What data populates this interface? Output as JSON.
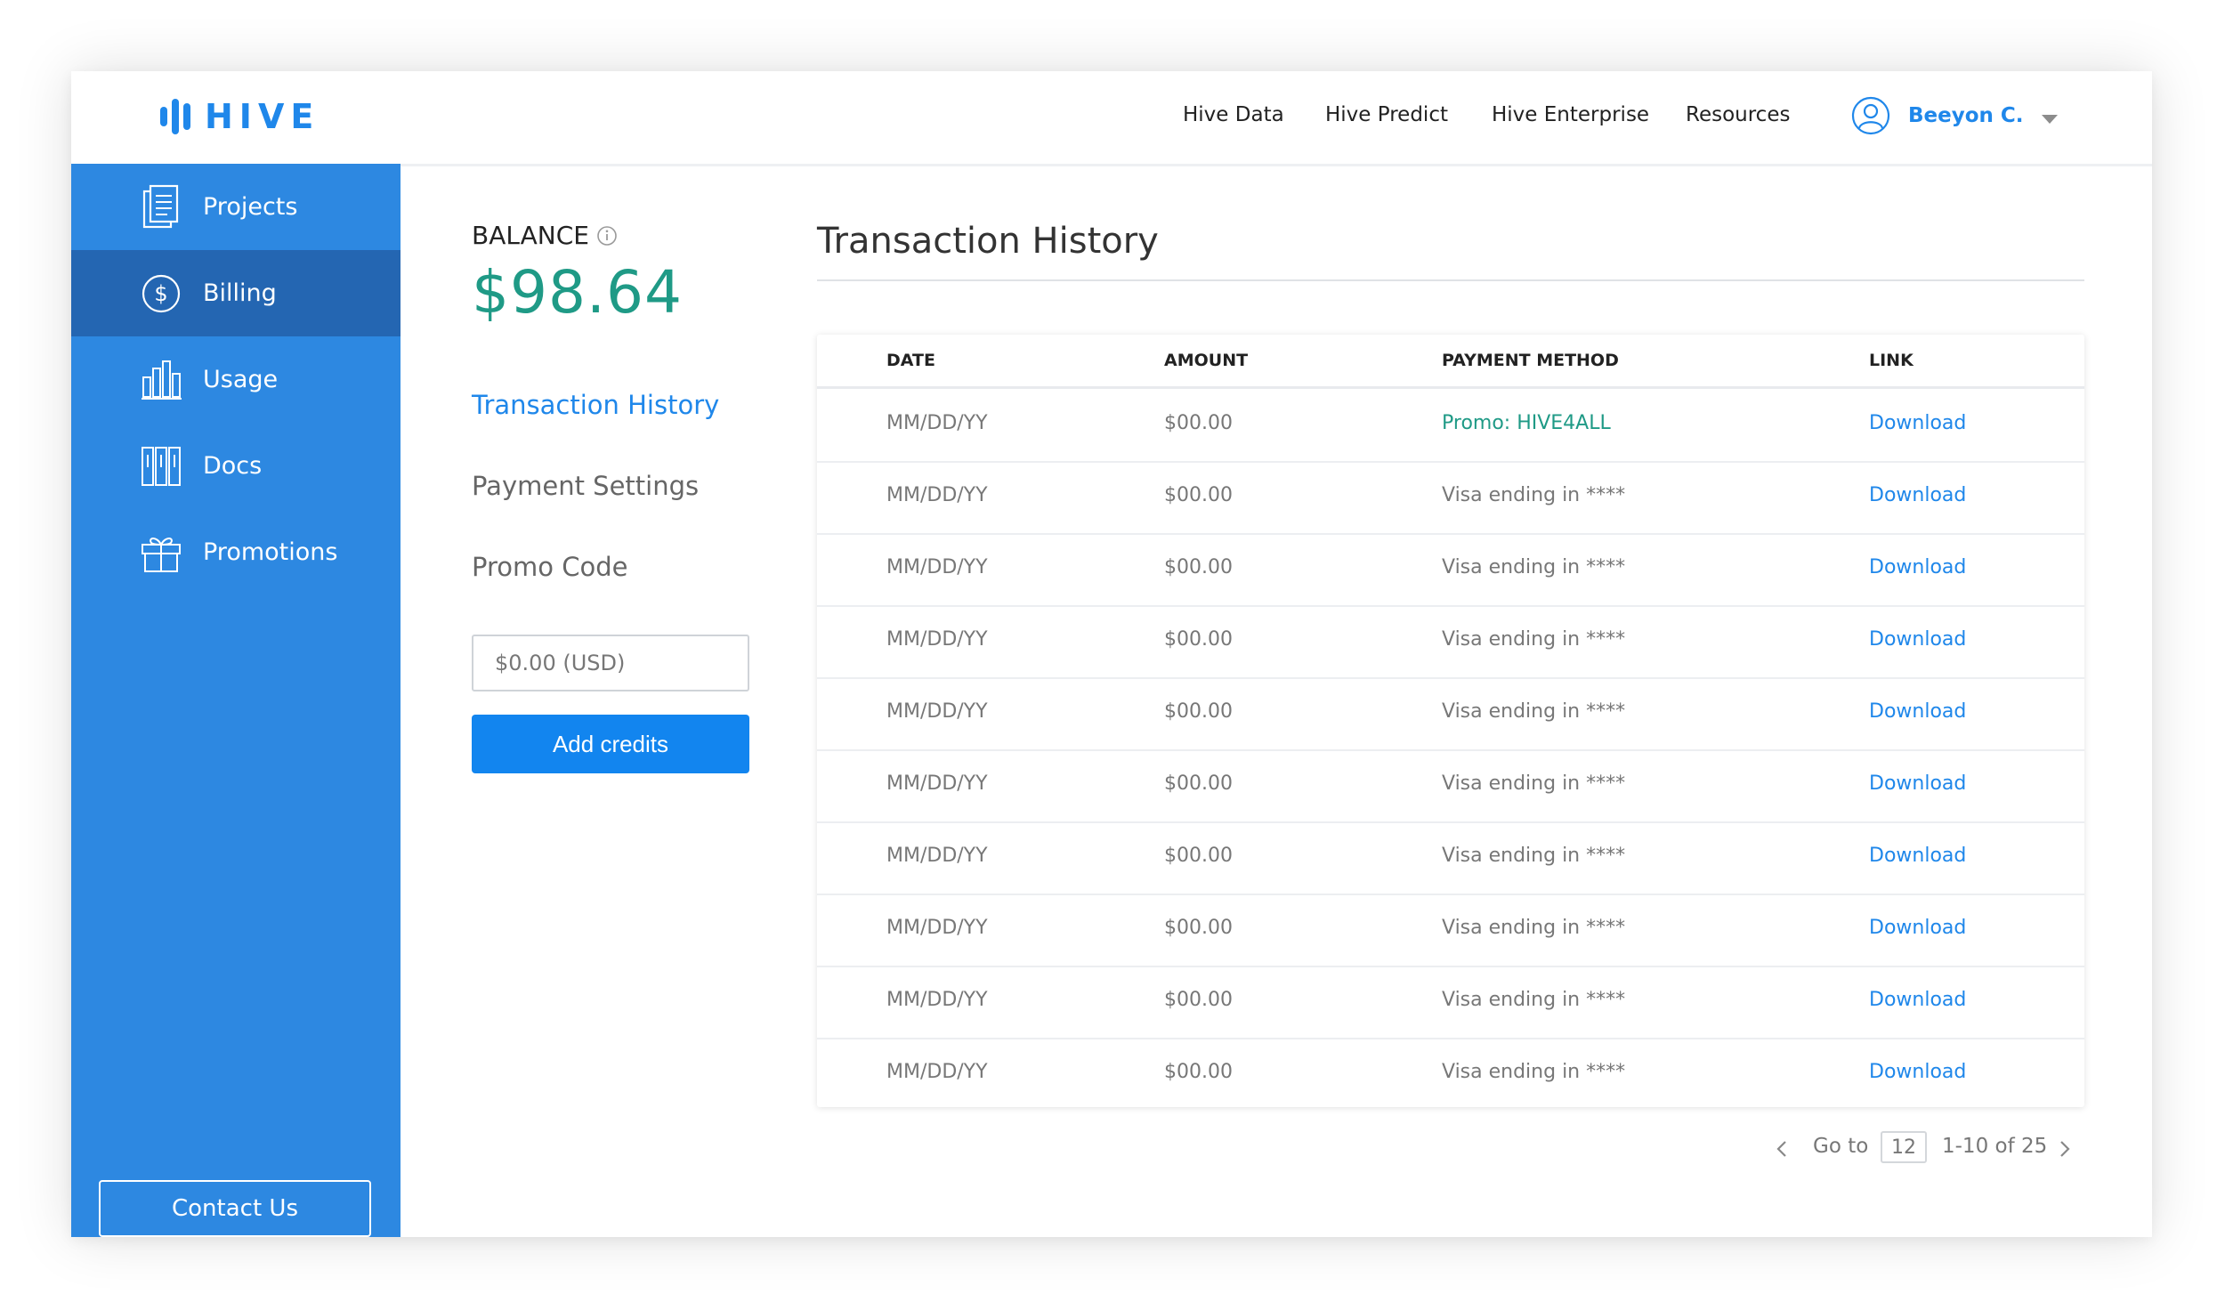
{
  "header": {
    "logo_text": "HIVE",
    "nav": [
      "Hive Data",
      "Hive Predict",
      "Hive Enterprise",
      "Resources"
    ],
    "user_name": "Beeyon C.",
    "brand_color": "#1f87ea"
  },
  "sidebar": {
    "items": [
      {
        "label": "Projects",
        "icon": "document-icon",
        "active": false
      },
      {
        "label": "Billing",
        "icon": "dollar-icon",
        "active": true
      },
      {
        "label": "Usage",
        "icon": "bar-chart-icon",
        "active": false
      },
      {
        "label": "Docs",
        "icon": "books-icon",
        "active": false
      },
      {
        "label": "Promotions",
        "icon": "gift-icon",
        "active": false
      }
    ],
    "contact_label": "Contact Us"
  },
  "balance": {
    "label": "BALANCE",
    "value": "$98.64"
  },
  "subnav": {
    "items": [
      "Transaction History",
      "Payment Settings",
      "Promo Code"
    ],
    "active": "Transaction History"
  },
  "credits": {
    "placeholder": "$0.00 (USD)",
    "button_label": "Add credits"
  },
  "history": {
    "title": "Transaction History",
    "columns": [
      "DATE",
      "AMOUNT",
      "PAYMENT METHOD",
      "LINK"
    ],
    "rows": [
      {
        "date": "MM/DD/YY",
        "amount": "$00.00",
        "method": "Promo: HIVE4ALL",
        "link": "Download"
      },
      {
        "date": "MM/DD/YY",
        "amount": "$00.00",
        "method": "Visa ending in ****",
        "link": "Download"
      },
      {
        "date": "MM/DD/YY",
        "amount": "$00.00",
        "method": "Visa ending in ****",
        "link": "Download"
      },
      {
        "date": "MM/DD/YY",
        "amount": "$00.00",
        "method": "Visa ending in ****",
        "link": "Download"
      },
      {
        "date": "MM/DD/YY",
        "amount": "$00.00",
        "method": "Visa ending in ****",
        "link": "Download"
      },
      {
        "date": "MM/DD/YY",
        "amount": "$00.00",
        "method": "Visa ending in ****",
        "link": "Download"
      },
      {
        "date": "MM/DD/YY",
        "amount": "$00.00",
        "method": "Visa ending in ****",
        "link": "Download"
      },
      {
        "date": "MM/DD/YY",
        "amount": "$00.00",
        "method": "Visa ending in ****",
        "link": "Download"
      },
      {
        "date": "MM/DD/YY",
        "amount": "$00.00",
        "method": "Visa ending in ****",
        "link": "Download"
      },
      {
        "date": "MM/DD/YY",
        "amount": "$00.00",
        "method": "Visa ending in ****",
        "link": "Download"
      }
    ]
  },
  "pagination": {
    "goto_label": "Go to",
    "page": "12",
    "range": "1-10 of 25"
  }
}
